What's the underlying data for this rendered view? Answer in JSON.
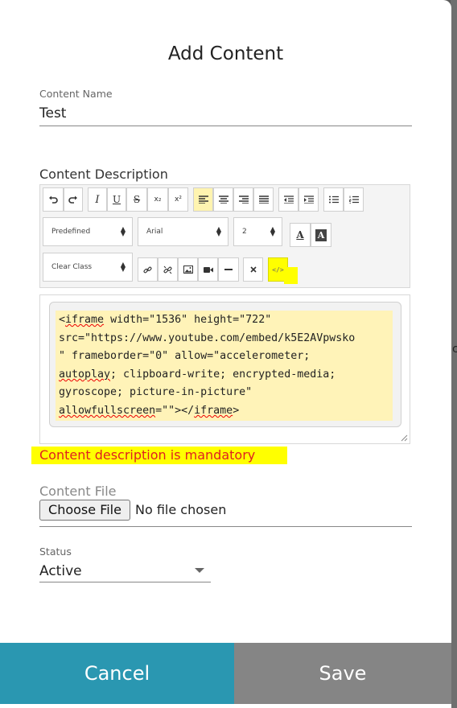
{
  "dialog": {
    "title": "Add Content"
  },
  "content_name": {
    "label": "Content Name",
    "value": "Test"
  },
  "content_description": {
    "label": "Content Description",
    "toolbar": {
      "predefined": "Predefined",
      "font": "Arial",
      "size": "2",
      "clear_class": "Clear Class",
      "italic": "I",
      "underline": "U",
      "strike": "S",
      "subscript": "x₂",
      "superscript": "x²",
      "font_color": "A",
      "bg_color": "A",
      "code_view": "</>"
    },
    "code_lines": [
      [
        "<",
        "iframe",
        " width=\"1536\" height=\"722\""
      ],
      [
        "src=\"https://www.youtube.com/embed/k5E2AVpwsko"
      ],
      [
        "\" frameborder=\"0\" allow=\"accelerometer;"
      ],
      [
        "",
        "autoplay",
        "; clipboard-write; encrypted-media;"
      ],
      [
        "gyroscope; picture-in-picture\""
      ],
      [
        "",
        "allowfullscreen",
        "=\"\"></",
        "iframe",
        ">"
      ]
    ]
  },
  "error": {
    "message": "Content description is mandatory"
  },
  "content_file": {
    "label": "Content File",
    "button_label": "Choose File",
    "status_text": "No file chosen"
  },
  "status": {
    "label": "Status",
    "value": "Active"
  },
  "footer": {
    "cancel_label": "Cancel",
    "save_label": "Save"
  },
  "colors": {
    "cancel_bg": "#2a97b1",
    "save_bg": "#858585",
    "error_text": "#e02020",
    "highlight": "#ffff00"
  },
  "icons": [
    "undo-icon",
    "redo-icon",
    "align-left-icon",
    "align-center-icon",
    "align-right-icon",
    "justify-icon",
    "outdent-icon",
    "indent-icon",
    "bullet-list-icon",
    "numbered-list-icon",
    "link-icon",
    "unlink-icon",
    "image-icon",
    "video-icon",
    "horizontal-rule-icon",
    "remove-format-icon",
    "code-view-icon",
    "select-arrows-icon",
    "resize-handle-icon",
    "dropdown-caret-icon"
  ]
}
